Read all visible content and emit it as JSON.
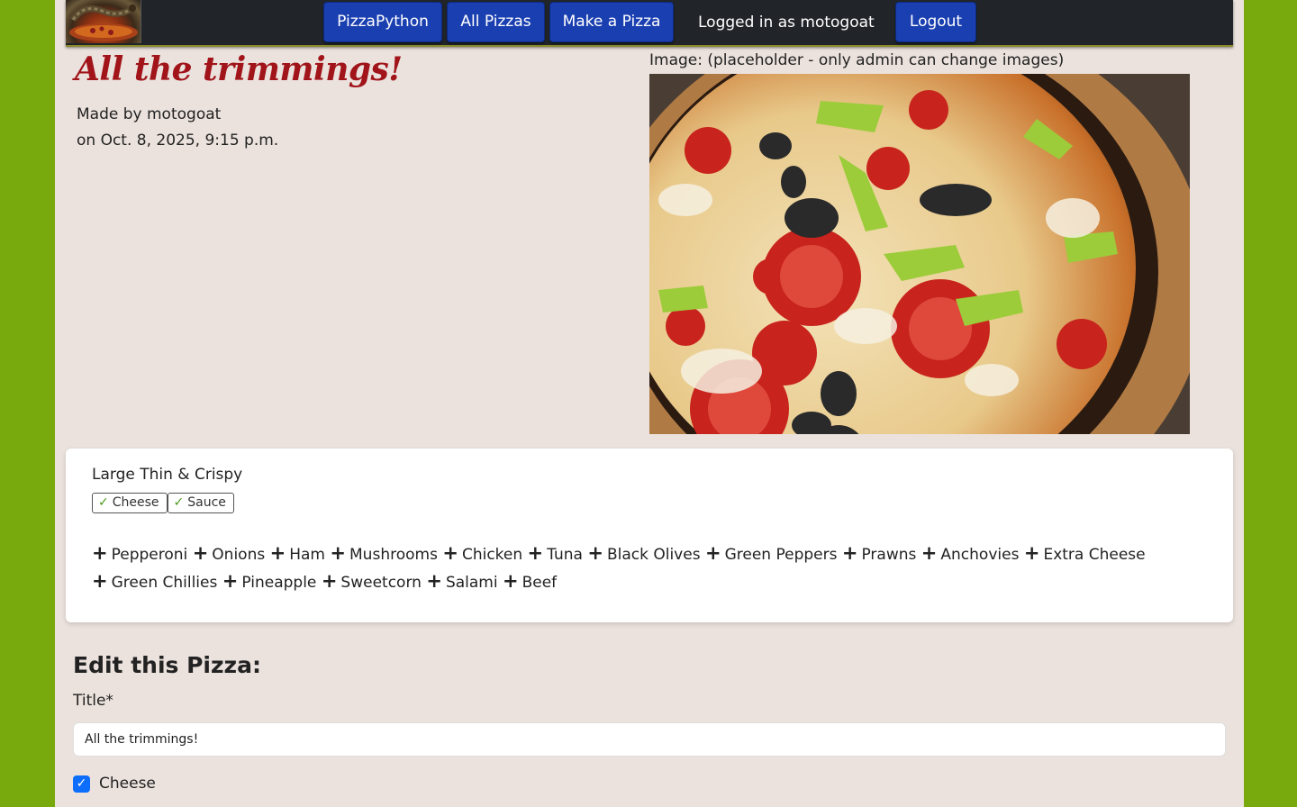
{
  "navbar": {
    "brand_label": "PizzaPython",
    "all_pizzas_label": "All Pizzas",
    "make_pizza_label": "Make a Pizza",
    "logged_in_text": "Logged in as motogoat",
    "logout_label": "Logout"
  },
  "pizza": {
    "title": "All the trimmings!",
    "made_by": "Made by motogoat",
    "made_on": "on Oct. 8, 2025, 9:15 p.m.",
    "image_caption": "Image: (placeholder - only admin can change images)"
  },
  "card": {
    "base": "Large Thin & Crispy",
    "badges": [
      "Cheese",
      "Sauce"
    ],
    "toppings": [
      "Pepperoni",
      "Onions",
      "Ham",
      "Mushrooms",
      "Chicken",
      "Tuna",
      "Black Olives",
      "Green Peppers",
      "Prawns",
      "Anchovies",
      "Extra Cheese",
      "Green Chillies",
      "Pineapple",
      "Sweetcorn",
      "Salami",
      "Beef"
    ]
  },
  "form": {
    "heading": "Edit this Pizza:",
    "title_label": "Title*",
    "title_value": "All the trimmings!",
    "cheese_label": "Cheese",
    "cheese_checked": true
  },
  "icons": {
    "badge_check": "check-icon",
    "topping_plus": "plus-icon"
  }
}
